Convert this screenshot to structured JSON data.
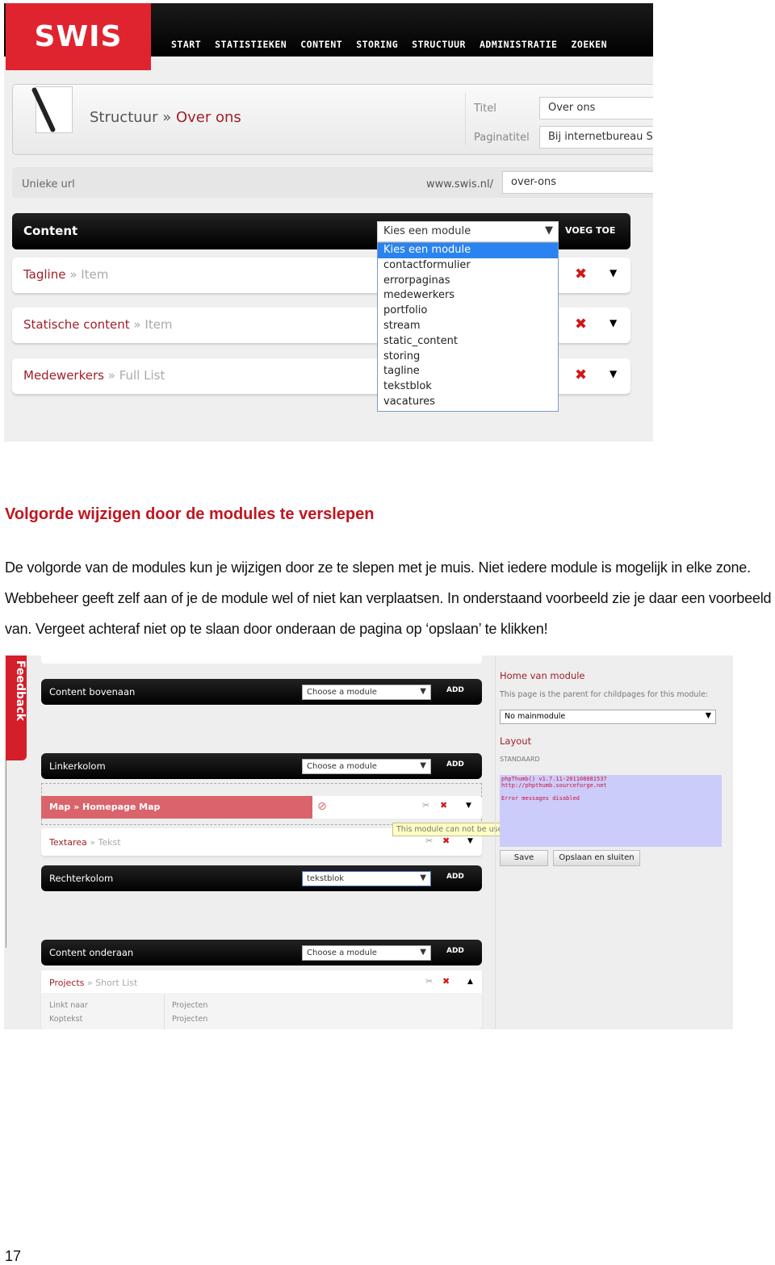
{
  "screenshot1": {
    "logo": "SWIS",
    "nav": [
      "START",
      "STATISTIEKEN",
      "CONTENT",
      "STORING",
      "STRUCTUUR",
      "ADMINISTRATIE",
      "ZOEKEN"
    ],
    "breadcrumb_parent": "Structuur",
    "breadcrumb_sep": "»",
    "breadcrumb_current": "Over ons",
    "titel_label": "Titel",
    "titel_value": "Over ons",
    "paginatitel_label": "Paginatitel",
    "paginatitel_value": "Bij internetbureau SWIS",
    "url_label": "Unieke url",
    "url_prefix": "www.swis.nl/",
    "url_value": "over-ons",
    "content_title": "Content",
    "select_value": "Kies een module",
    "add_button": "VOEG TOE",
    "modules": [
      {
        "name": "Tagline",
        "type": "Item"
      },
      {
        "name": "Statische content",
        "type": "Item"
      },
      {
        "name": "Medewerkers",
        "type": "Full List"
      }
    ],
    "dropdown_options": [
      "Kies een module",
      "contactformulier",
      "errorpaginas",
      "medewerkers",
      "portfolio",
      "stream",
      "static_content",
      "storing",
      "tagline",
      "tekstblok",
      "vacatures"
    ]
  },
  "heading": "Volgorde wijzigen door de modules te verslepen",
  "paragraph": "De volgorde van de modules kun je wijzigen door ze te slepen met je muis. Niet iedere module is mogelijk in elke zone. Webbeheer geeft zelf aan of je de module wel of niet kan verplaatsen. In onderstaand voorbeeld zie je daar een voorbeeld van. Vergeet achteraf niet op te slaan door onderaan de pagina op ‘opslaan’ te klikken!",
  "screenshot2": {
    "feedback": "Feedback",
    "zones": [
      {
        "title": "Content bovenaan",
        "select": "Choose a module",
        "add": "ADD"
      },
      {
        "title": "Linkerkolom",
        "select": "Choose a module",
        "add": "ADD"
      },
      {
        "title": "Rechterkolom",
        "select": "tekstblok",
        "add": "ADD"
      },
      {
        "title": "Content onderaan",
        "select": "Choose a module",
        "add": "ADD"
      }
    ],
    "dragged_module": "Map » Homepage Map",
    "textarea_module": {
      "name": "Textarea",
      "type": "Tekst"
    },
    "projects_module": {
      "name": "Projects",
      "type": "Short List"
    },
    "projects_details": [
      {
        "label": "Linkt naar",
        "value": "Projecten"
      },
      {
        "label": "Koptekst",
        "value": "Projecten"
      }
    ],
    "tooltip": "This module can not be used within this zone",
    "home_heading": "Home van module",
    "home_desc": "This page is the parent for childpages for this module:",
    "home_select": "No mainmodule",
    "layout_heading": "Layout",
    "layout_value": "STANDAARD",
    "thumb_lines": [
      "phpThumb() v1.7.11-201108081537",
      "http://phpthumb.sourceforge.net",
      "",
      "Error messages disabled"
    ],
    "save": "Save",
    "save_close": "Opslaan en sluiten"
  },
  "page_number": "17",
  "colors": {
    "brand_red": "#e0242f",
    "link_red": "#a0202a",
    "heading_red": "#c0161f",
    "drag_red": "#d9646b",
    "selected_blue": "#2a83f0"
  }
}
